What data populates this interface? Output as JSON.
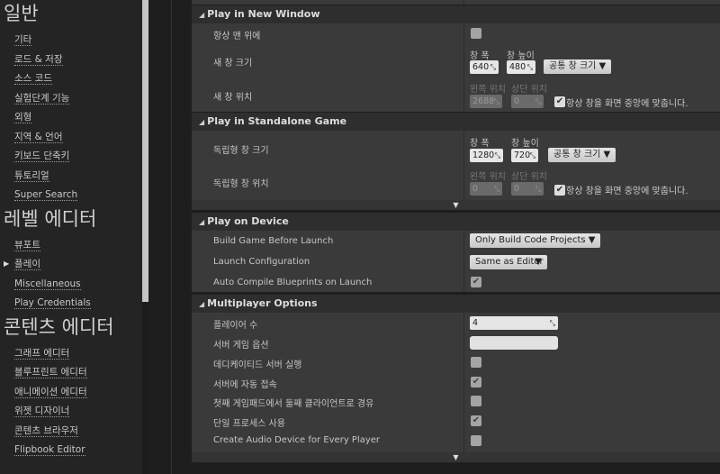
{
  "sidebar": {
    "categories": [
      {
        "title": "일반",
        "items": [
          "기타",
          "로드 & 저장",
          "소스 코드",
          "실험단계 기능",
          "외형",
          "지역 & 언어",
          "키보드 단축키",
          "튜토리얼",
          "Super Search"
        ]
      },
      {
        "title": "레벨 에디터",
        "items": [
          "뷰포트",
          "플레이",
          "Miscellaneous",
          "Play Credentials"
        ]
      },
      {
        "title": "콘텐츠 에디터",
        "items": [
          "그래프 에디터",
          "블루프린트 에디터",
          "애니메이션 에디터",
          "위젯 디자이너",
          "콘텐츠 브라우저",
          "Flipbook Editor"
        ]
      }
    ],
    "selected_arrow": "▶"
  },
  "sections": {
    "new_window": {
      "title": "Play in New Window",
      "always_on_top": "항상 맨 위에",
      "size_label": "새 창 크기",
      "width_label": "창 폭",
      "height_label": "창 높이",
      "width": "640",
      "height": "480",
      "common_sizes": "공통 창 크기",
      "pos_label": "새 창 위치",
      "left_label": "왼쪽 위치",
      "top_label": "상단 위치",
      "left": "2688",
      "top": "0",
      "center": "항상 창을 화면 중앙에 맞춥니다."
    },
    "standalone": {
      "title": "Play in Standalone Game",
      "size_label": "독립형 창 크기",
      "width_label": "창 폭",
      "height_label": "창 높이",
      "width": "1280",
      "height": "720",
      "common_sizes": "공통 창 크기",
      "pos_label": "독립형 창 위치",
      "left_label": "왼쪽 위치",
      "top_label": "상단 위치",
      "left": "0",
      "top": "0",
      "center": "항상 창을 화면 중앙에 맞춥니다."
    },
    "device": {
      "title": "Play on Device",
      "build_label": "Build Game Before Launch",
      "build_value": "Only Build Code Projects",
      "launch_label": "Launch Configuration",
      "launch_value": "Same as Editor",
      "autocompile_label": "Auto Compile Blueprints on Launch",
      "autocompile": true
    },
    "multiplayer": {
      "title": "Multiplayer Options",
      "players_label": "플레이어 수",
      "players": "4",
      "server_opts_label": "서버 게임 옵션",
      "server_opts": "",
      "dedicated_label": "데디케이티드 서버 실행",
      "dedicated": false,
      "autoconnect_label": "서버에 자동 접속",
      "autoconnect": true,
      "gamepad_label": "첫째 게임패드에서 둘째 클라이언트로 경유",
      "gamepad": false,
      "single_process_label": "단일 프로세스 사용",
      "single_process": true,
      "audio_label": "Create Audio Device for Every Player",
      "audio": false
    }
  }
}
